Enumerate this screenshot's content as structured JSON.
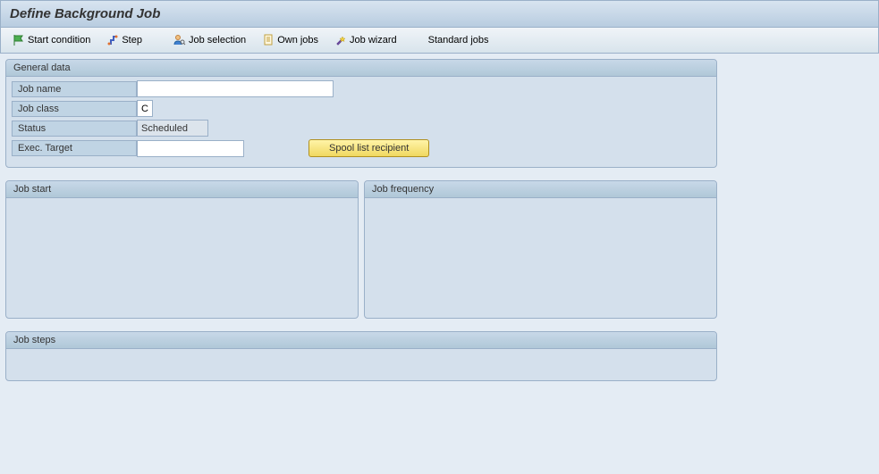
{
  "title": "Define Background Job",
  "toolbar": {
    "start_condition": "Start condition",
    "step": "Step",
    "job_selection": "Job selection",
    "own_jobs": "Own jobs",
    "job_wizard": "Job wizard",
    "standard_jobs": "Standard jobs"
  },
  "general_data": {
    "title": "General data",
    "job_name_label": "Job name",
    "job_name_value": "",
    "job_class_label": "Job class",
    "job_class_value": "C",
    "status_label": "Status",
    "status_value": "Scheduled",
    "exec_target_label": "Exec. Target",
    "exec_target_value": "",
    "spool_button": "Spool list recipient"
  },
  "job_start": {
    "title": "Job start"
  },
  "job_frequency": {
    "title": "Job frequency"
  },
  "job_steps": {
    "title": "Job steps"
  }
}
